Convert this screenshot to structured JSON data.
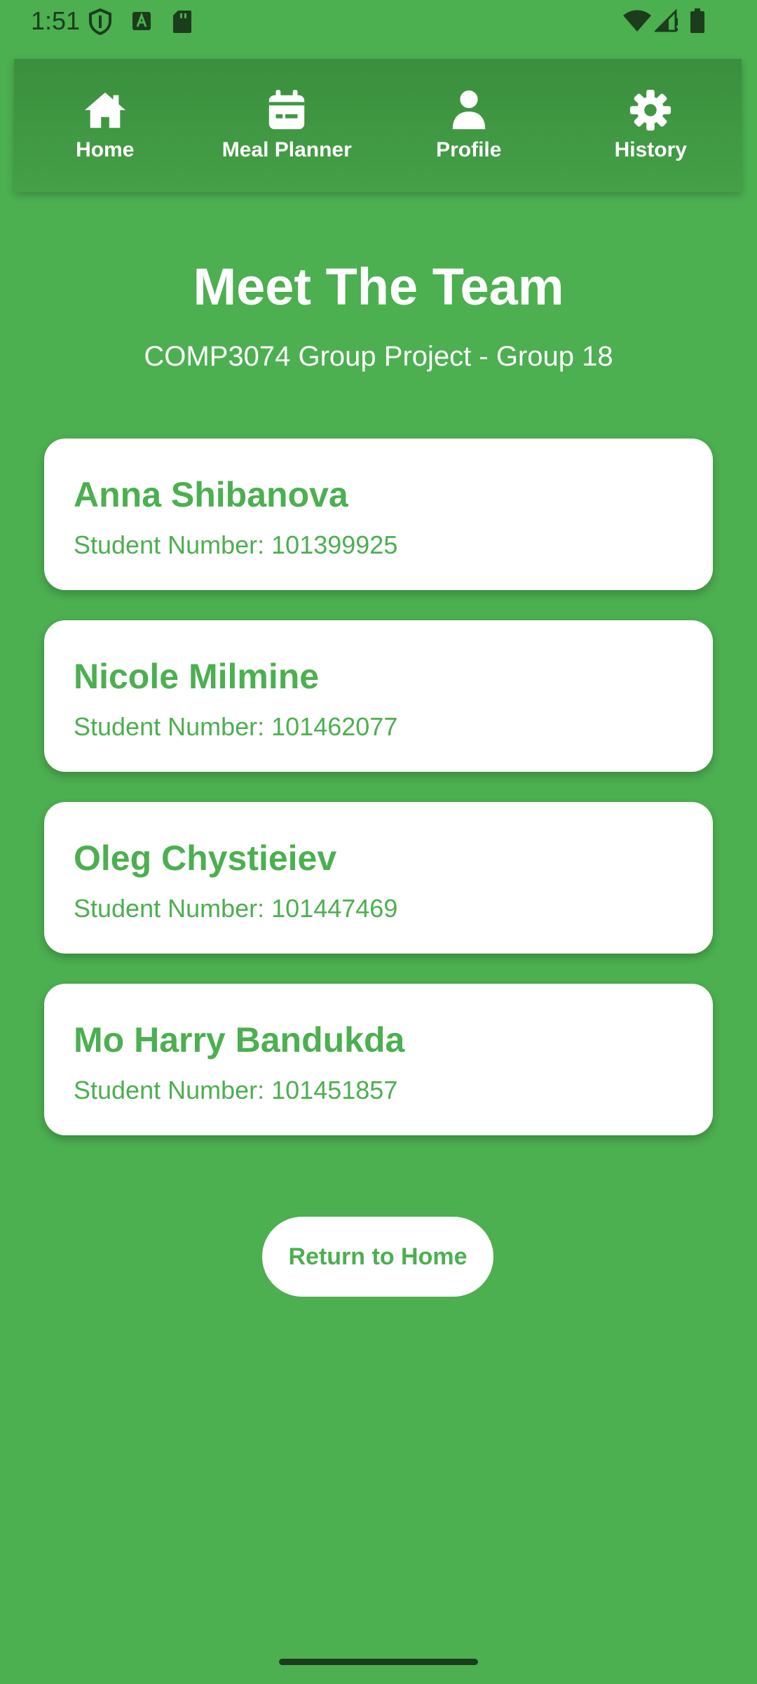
{
  "status_bar": {
    "time": "1:51",
    "icons_left": [
      "shield-icon",
      "a-notification-icon",
      "sd-card-icon"
    ],
    "icons_right": [
      "wifi-icon",
      "signal-icon",
      "battery-icon"
    ]
  },
  "nav": {
    "items": [
      {
        "label": "Home",
        "icon": "home-icon"
      },
      {
        "label": "Meal Planner",
        "icon": "calendar-icon"
      },
      {
        "label": "Profile",
        "icon": "person-icon"
      },
      {
        "label": "History",
        "icon": "gear-icon"
      }
    ]
  },
  "header": {
    "title": "Meet The Team",
    "subtitle": "COMP3074 Group Project - Group 18"
  },
  "team": [
    {
      "name": "Anna Shibanova",
      "student_number": "Student Number: 101399925"
    },
    {
      "name": "Nicole Milmine",
      "student_number": "Student Number: 101462077"
    },
    {
      "name": "Oleg Chystieiev",
      "student_number": "Student Number: 101447469"
    },
    {
      "name": "Mo Harry Bandukda",
      "student_number": "Student Number: 101451857"
    }
  ],
  "actions": {
    "return_home_label": "Return to Home"
  },
  "colors": {
    "background": "#4caf50",
    "nav_bar": "#3a8f3d",
    "card": "#ffffff",
    "accent_text": "#4caf50"
  }
}
